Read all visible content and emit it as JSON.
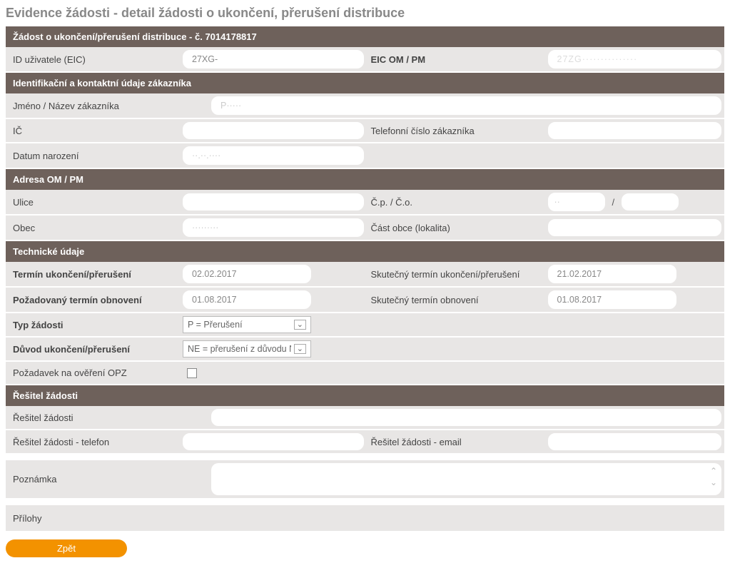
{
  "page_title": "Evidence žádosti - detail žádosti o ukončení, přerušení distribuce",
  "sections": {
    "request": {
      "header": "Žádost o ukončení/přerušení distribuce - č. 7014178817",
      "fields": {
        "id_user_label": "ID uživatele (EIC)",
        "id_user_value": "27XG-",
        "eic_label": "EIC OM / PM",
        "eic_value": "27ZG···············"
      }
    },
    "contact": {
      "header": "Identifikační a kontaktní údaje zákazníka",
      "fields": {
        "name_label": "Jméno / Název zákazníka",
        "name_value": "P·····",
        "ico_label": "IČ",
        "ico_value": "",
        "phone_label": "Telefonní číslo zákazníka",
        "phone_value": "",
        "dob_label": "Datum narození",
        "dob_value": "··.··.····"
      }
    },
    "address": {
      "header": "Adresa OM / PM",
      "fields": {
        "street_label": "Ulice",
        "street_value": "",
        "cp_label": "Č.p. / Č.o.",
        "cp_value": "··",
        "co_value": "",
        "slash": "/",
        "city_label": "Obec",
        "city_value": "·········",
        "part_label": "Část obce (lokalita)",
        "part_value": ""
      }
    },
    "tech": {
      "header": "Technické údaje",
      "fields": {
        "term_label": "Termín ukončení/přerušení",
        "term_value": "02.02.2017",
        "real_term_label": "Skutečný termín ukončení/přerušení",
        "real_term_value": "21.02.2017",
        "req_renew_label": "Požadovaný termín obnovení",
        "req_renew_value": "01.08.2017",
        "real_renew_label": "Skutečný termín obnovení",
        "real_renew_value": "01.08.2017",
        "type_label": "Typ žádosti",
        "type_value": "P = Přerušení",
        "reason_label": "Důvod ukončení/přerušení",
        "reason_value": "NE = přerušení z důvodu NEplac",
        "opz_label": "Požadavek na ověření OPZ"
      }
    },
    "solver": {
      "header": "Řešitel žádosti",
      "fields": {
        "solver_label": "Řešitel žádosti",
        "solver_value": "",
        "solver_phone_label": "Řešitel žádosti - telefon",
        "solver_phone_value": "",
        "solver_email_label": "Řešitel žádosti - email",
        "solver_email_value": ""
      }
    },
    "note": {
      "label": "Poznámka",
      "value": ""
    },
    "attachments": {
      "label": "Přílohy"
    }
  },
  "buttons": {
    "back": "Zpět"
  }
}
